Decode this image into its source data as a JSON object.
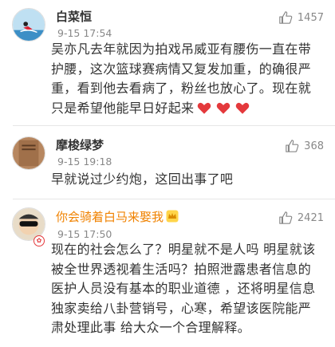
{
  "comments": [
    {
      "user": "白菜恒",
      "time": "9-15 17:54",
      "likes": "1457",
      "text": "吴亦凡去年就因为拍戏吊威亚有腰伤一直在带护腰，这次篮球赛病情又复发加重，的确很严重，看到他去看病了，粉丝也放心了。现在就只是希望他能早日好起来",
      "emoji": [
        "heart-emoji",
        "heart-emoji",
        "heart-emoji"
      ]
    },
    {
      "user": "摩梭绿梦",
      "time": "9-15 19:18",
      "likes": "368",
      "text": "早就说过少约炮，这回出事了吧"
    },
    {
      "user": "你会骑着白马来娶我",
      "time": "9-15 17:50",
      "likes": "2421",
      "text": "现在的社会怎么了？明星就不是人吗 明星就该被全世界透视着生活吗？拍照泄露患者信息的医护人员没有基本的职业道德 ，还将明星信息独家卖给八卦营销号，心寒，希望该医院能严肃处理此事 给大众一个合理解释。",
      "badge_icon": "crown-icon",
      "name_color": "#f08200"
    }
  ],
  "colors": {
    "accent_orange": "#f08200",
    "heart_red": "#e4393c",
    "meta_gray": "#888888"
  },
  "icons": {
    "like": "thumbs-up-icon",
    "avatar_badge": "vip-badge-icon"
  }
}
